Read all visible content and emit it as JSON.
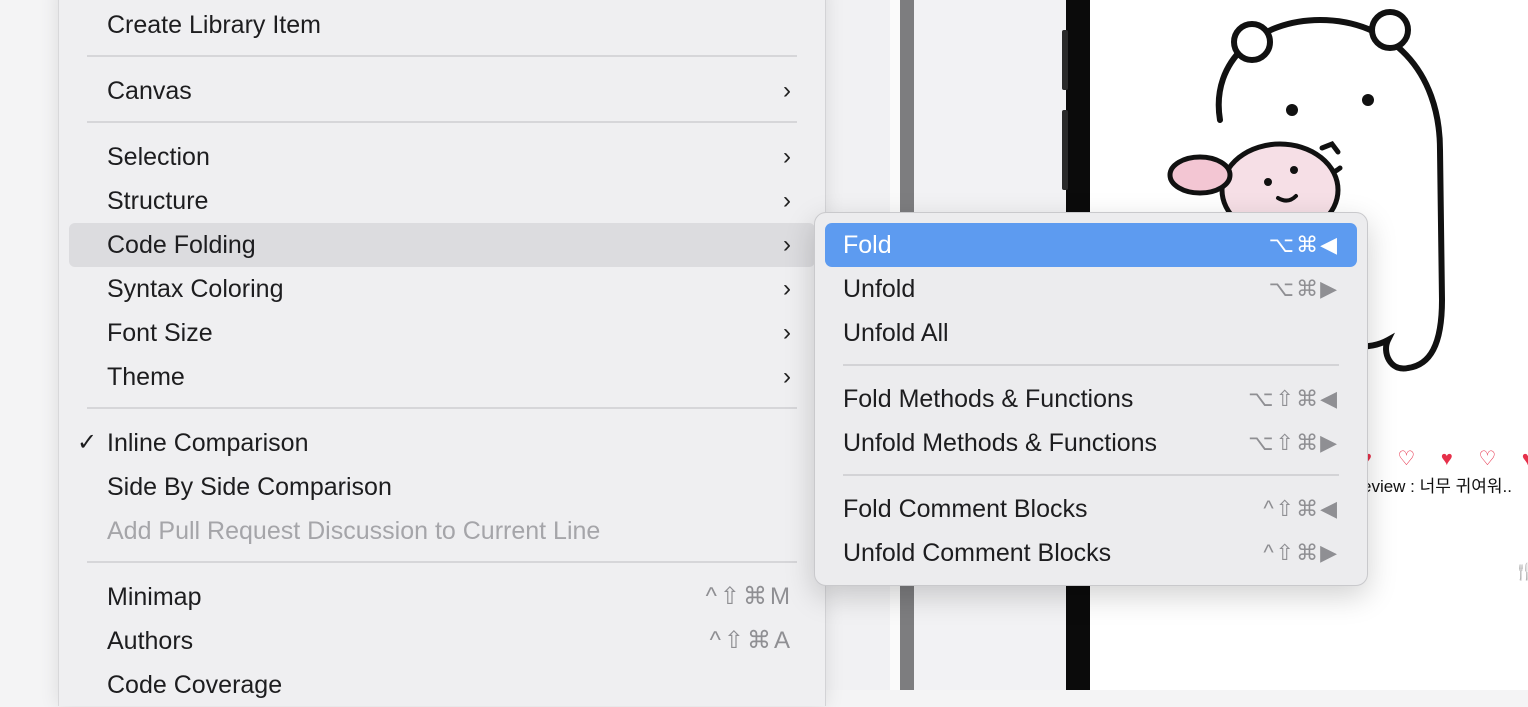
{
  "main_menu": {
    "items": [
      {
        "label": "Create Library Item"
      },
      {
        "label": "Canvas",
        "has_submenu": true
      },
      {
        "label": "Selection",
        "has_submenu": true
      },
      {
        "label": "Structure",
        "has_submenu": true
      },
      {
        "label": "Code Folding",
        "has_submenu": true,
        "highlighted": true
      },
      {
        "label": "Syntax Coloring",
        "has_submenu": true
      },
      {
        "label": "Font Size",
        "has_submenu": true
      },
      {
        "label": "Theme",
        "has_submenu": true
      },
      {
        "label": "Inline Comparison",
        "checked": true,
        "check_mark": "✓"
      },
      {
        "label": "Side By Side Comparison"
      },
      {
        "label": "Add Pull Request Discussion to Current Line",
        "disabled": true
      },
      {
        "label": "Minimap",
        "shortcut": "^⇧⌘M"
      },
      {
        "label": "Authors",
        "shortcut": "^⇧⌘A"
      },
      {
        "label": "Code Coverage"
      }
    ],
    "chevron": "›"
  },
  "submenu": {
    "items": [
      {
        "label": "Fold",
        "shortcut": "⌥⌘◀",
        "active": true
      },
      {
        "label": "Unfold",
        "shortcut": "⌥⌘▶"
      },
      {
        "label": "Unfold All",
        "shortcut": ""
      },
      {
        "label": "Fold Methods & Functions",
        "shortcut": "⌥⇧⌘◀"
      },
      {
        "label": "Unfold Methods & Functions",
        "shortcut": "⌥⇧⌘▶"
      },
      {
        "label": "Fold Comment Blocks",
        "shortcut": "^⇧⌘◀"
      },
      {
        "label": "Unfold Comment Blocks",
        "shortcut": "^⇧⌘▶"
      }
    ]
  },
  "preview": {
    "hearts": "♥ ♡ ♥ ♡ ♥",
    "review_text": "eview : 너무 귀여워..",
    "utensils_icon": "🍴",
    "illustration": "bear-hugging-bunny-sticker"
  },
  "colors": {
    "selection_blue": "#5d9bf0",
    "hover_gray": "#dcdcdf",
    "heart_red": "#e6304a"
  }
}
